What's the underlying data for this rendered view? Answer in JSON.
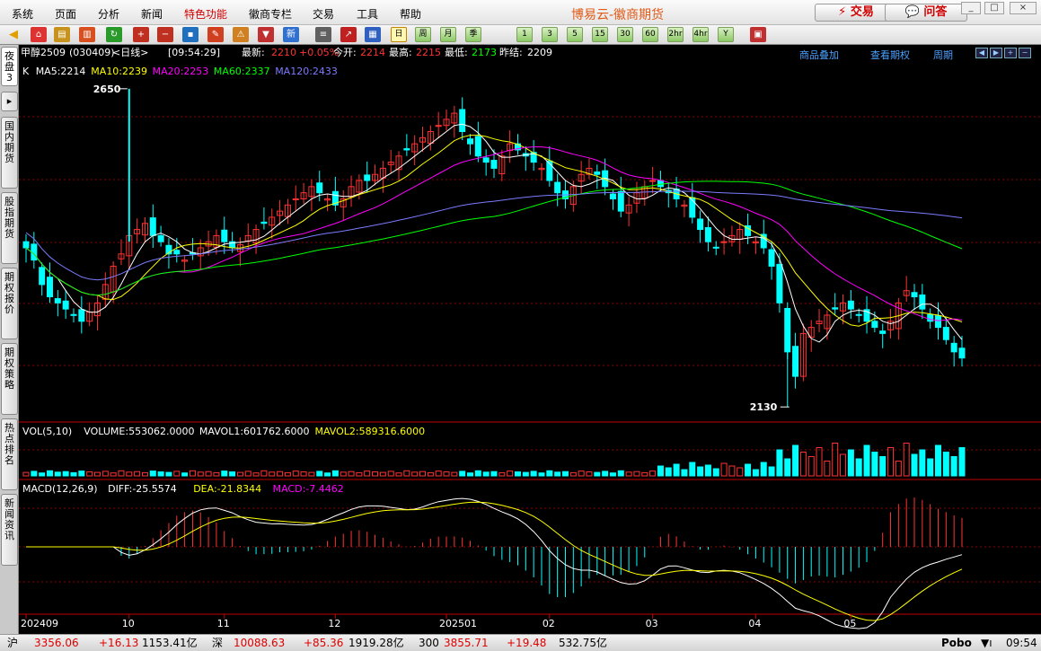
{
  "menu": [
    "系统",
    "页面",
    "分析",
    "新闻",
    "特色功能",
    "徽商专栏",
    "交易",
    "工具",
    "帮助"
  ],
  "app_title": "博易云-徽商期货",
  "top_buttons": {
    "trade": "交易",
    "qa": "问答"
  },
  "window_controls": [
    "_",
    "□",
    "×"
  ],
  "toolbar": {
    "icons": [
      "back-icon",
      "home-icon",
      "database-icon",
      "report-icon",
      "refresh-icon",
      "zoom-in-icon",
      "zoom-out-icon",
      "indicator-icon",
      "pen-icon",
      "alert-icon",
      "filter-icon",
      "news-icon",
      "grid-icon",
      "trend-icon",
      "period-icon"
    ],
    "periods": [
      "日",
      "周",
      "月",
      "季",
      "1",
      "3",
      "5",
      "15",
      "30",
      "60",
      "2hr",
      "4hr",
      "Y"
    ],
    "active_period": "日"
  },
  "side_tabs": [
    "夜盘3",
    "▸",
    "国内期货",
    "股指期货",
    "期权报价",
    "期权策略",
    "热点排名",
    "新闻资讯"
  ],
  "info": {
    "symbol": "甲醇2509",
    "code": "(030409)",
    "period": "<日线>",
    "time": "[09:54:29]",
    "latest_label": "最新:",
    "latest": "2210",
    "change": "+0.05%",
    "open_label": "今开:",
    "open": "2214",
    "high_label": "最高:",
    "high": "2215",
    "low_label": "最低:",
    "low": "2173",
    "prev_label": "昨结:",
    "prev": "2209"
  },
  "links": {
    "overlay": "商品叠加",
    "view_options": "查看期权",
    "period": "周期"
  },
  "ma_legend": [
    {
      "text": "K",
      "color": "#ffffff"
    },
    {
      "text": "MA5:2214",
      "color": "#ffffff"
    },
    {
      "text": "MA10:2239",
      "color": "#ffff00"
    },
    {
      "text": "MA20:2253",
      "color": "#ff00ff"
    },
    {
      "text": "MA60:2337",
      "color": "#00ff00"
    },
    {
      "text": "MA120:2433",
      "color": "#7b7bff"
    }
  ],
  "vol_legend": [
    {
      "text": "VOL(5,10)",
      "color": "#ffffff"
    },
    {
      "text": "VOLUME:553062.0000",
      "color": "#ffffff"
    },
    {
      "text": "MAVOL1:601762.6000",
      "color": "#ffffff"
    },
    {
      "text": "MAVOL2:589316.6000",
      "color": "#ffff00"
    }
  ],
  "macd_legend": [
    {
      "text": "MACD(12,26,9)",
      "color": "#ffffff"
    },
    {
      "text": "DIFF:-25.5574",
      "color": "#ffffff"
    },
    {
      "text": "DEA:-21.8344",
      "color": "#ffff00"
    },
    {
      "text": "MACD:-7.4462",
      "color": "#ff00ff"
    }
  ],
  "annotations": {
    "high": "2650",
    "low": "2130"
  },
  "colors": {
    "up": "#ff3232",
    "down": "#00ffff",
    "grid": "#8b0000",
    "ma5": "#ffffff",
    "ma10": "#ffff00",
    "ma20": "#ff00ff",
    "ma60": "#00ff00",
    "ma120": "#7b7bff"
  },
  "chart_data": {
    "type": "candlestick",
    "price_high": 2650,
    "price_low": 2130,
    "x_tick_labels": [
      "202409",
      "10",
      "11",
      "12",
      "202501",
      "02",
      "03",
      "04",
      "05"
    ],
    "last_close": 2210,
    "closes": [
      2390,
      2370,
      2330,
      2310,
      2300,
      2290,
      2280,
      2270,
      2285,
      2300,
      2330,
      2360,
      2380,
      2410,
      2420,
      2430,
      2410,
      2400,
      2380,
      2380,
      2370,
      2380,
      2390,
      2400,
      2410,
      2400,
      2390,
      2395,
      2410,
      2420,
      2430,
      2440,
      2450,
      2460,
      2470,
      2480,
      2490,
      2480,
      2470,
      2460,
      2470,
      2490,
      2500,
      2500,
      2510,
      2520,
      2530,
      2540,
      2550,
      2560,
      2570,
      2580,
      2590,
      2600,
      2610,
      2580,
      2560,
      2540,
      2530,
      2520,
      2540,
      2560,
      2550,
      2540,
      2530,
      2520,
      2500,
      2480,
      2470,
      2490,
      2510,
      2520,
      2510,
      2490,
      2470,
      2450,
      2460,
      2480,
      2490,
      2500,
      2490,
      2480,
      2470,
      2460,
      2440,
      2420,
      2400,
      2390,
      2400,
      2410,
      2420,
      2410,
      2400,
      2390,
      2360,
      2300,
      2220,
      2180,
      2250,
      2260,
      2270,
      2280,
      2290,
      2300,
      2290,
      2280,
      2270,
      2260,
      2250,
      2270,
      2300,
      2320,
      2310,
      2290,
      2270,
      2260,
      2240,
      2220,
      2210
    ]
  }
}
